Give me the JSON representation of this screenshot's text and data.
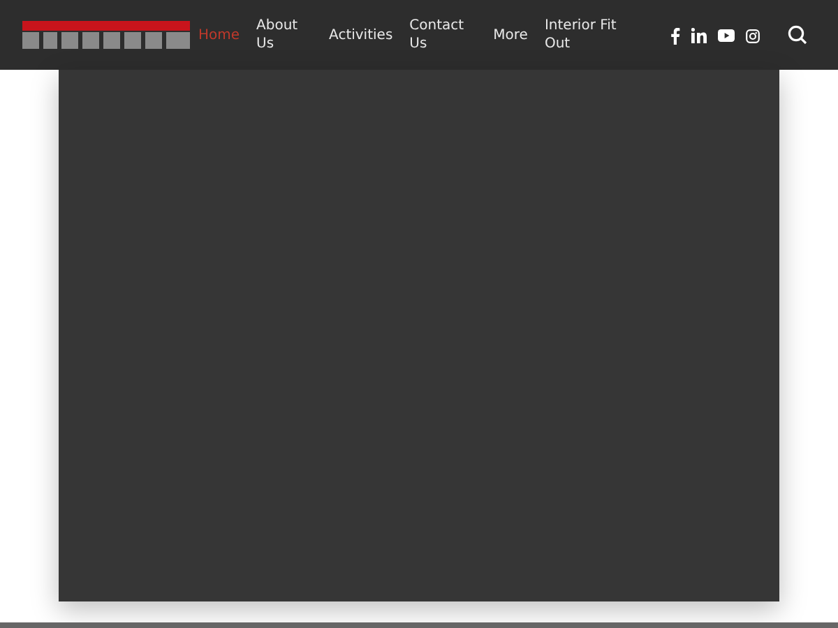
{
  "nav": {
    "items": [
      {
        "label": "Home",
        "selected": true
      },
      {
        "label": "About Us",
        "selected": false
      },
      {
        "label": "Activities",
        "selected": false
      },
      {
        "label": "Contact Us",
        "selected": false
      },
      {
        "label": "More",
        "selected": false
      },
      {
        "label": "Interior Fit Out",
        "selected": false
      }
    ],
    "social": [
      {
        "kind": "facebook"
      },
      {
        "kind": "linkedin"
      },
      {
        "kind": "youtube"
      },
      {
        "kind": "instagram"
      }
    ]
  }
}
